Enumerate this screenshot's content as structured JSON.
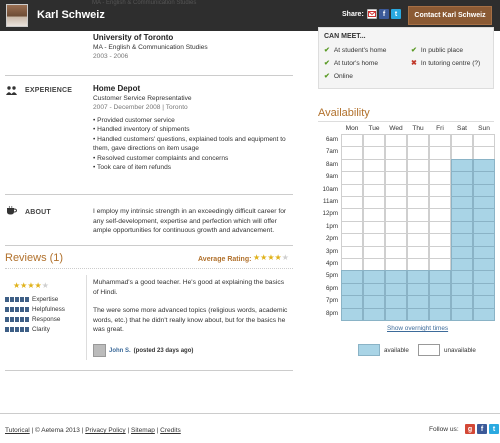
{
  "header": {
    "name": "Karl Schweiz",
    "ghost_text": "MA - English & Communication Studies",
    "share_label": "Share:",
    "contact_label": "Contact Karl Schweiz"
  },
  "education": {
    "school": "University of Toronto",
    "degree": "MA - English & Communication Studies",
    "dates": "2003 - 2006"
  },
  "experience": {
    "label": "EXPERIENCE",
    "company": "Home Depot",
    "role": "Customer Service Representative",
    "dates": "2007 - December 2008 | Toronto",
    "bullets": [
      "• Provided customer service",
      "• Handled inventory of shipments",
      "• Handled customers' questions, explained tools and equipment to",
      "them, gave directions on item usage",
      "• Resolved customer complaints and concerns",
      "• Took care of item refunds"
    ]
  },
  "about": {
    "label": "ABOUT",
    "text": "I employ my intrinsic strength in an exceedingly difficult career for any self-development, expertise and perfection which will offer ample opportunities for continuous growth and advancement."
  },
  "reviews": {
    "title": "Reviews (1)",
    "avg_label": "Average Rating:",
    "avg_stars": 4,
    "review_stars": 4,
    "metrics": [
      {
        "label": "Expertise",
        "score": 5
      },
      {
        "label": "Helpfulness",
        "score": 5
      },
      {
        "label": "Response",
        "score": 5
      },
      {
        "label": "Clarity",
        "score": 5
      }
    ],
    "text_1": "Muhammad's a good teacher. He's good at explaining the basics of Hindi.",
    "text_2": "The were some more advanced topics (religious words, academic words, etc.) that he didn't really know about, but for the basics he was great.",
    "reviewer_name": "John S.",
    "reviewer_time": "(posted 23 days ago)"
  },
  "can_meet": {
    "title": "CAN MEET...",
    "options": [
      {
        "label": "At student's home",
        "allowed": true
      },
      {
        "label": "In public place",
        "allowed": true
      },
      {
        "label": "At tutor's home",
        "allowed": true
      },
      {
        "label": "In tutoring centre (?)",
        "allowed": false
      },
      {
        "label": "Online",
        "allowed": true
      }
    ]
  },
  "availability": {
    "title": "Availability",
    "days": [
      "Mon",
      "Tue",
      "Wed",
      "Thu",
      "Fri",
      "Sat",
      "Sun"
    ],
    "times": [
      "6am",
      "7am",
      "8am",
      "9am",
      "10am",
      "11am",
      "12pm",
      "1pm",
      "2pm",
      "3pm",
      "4pm",
      "5pm",
      "6pm",
      "7pm",
      "8pm"
    ],
    "available": [
      [
        0,
        0,
        0,
        0,
        0,
        0,
        0
      ],
      [
        0,
        0,
        0,
        0,
        0,
        0,
        0
      ],
      [
        0,
        0,
        0,
        0,
        0,
        1,
        1
      ],
      [
        0,
        0,
        0,
        0,
        0,
        1,
        1
      ],
      [
        0,
        0,
        0,
        0,
        0,
        1,
        1
      ],
      [
        0,
        0,
        0,
        0,
        0,
        1,
        1
      ],
      [
        0,
        0,
        0,
        0,
        0,
        1,
        1
      ],
      [
        0,
        0,
        0,
        0,
        0,
        1,
        1
      ],
      [
        0,
        0,
        0,
        0,
        0,
        1,
        1
      ],
      [
        0,
        0,
        0,
        0,
        0,
        1,
        1
      ],
      [
        0,
        0,
        0,
        0,
        0,
        1,
        1
      ],
      [
        1,
        1,
        1,
        1,
        1,
        1,
        1
      ],
      [
        1,
        1,
        1,
        1,
        1,
        1,
        1
      ],
      [
        1,
        1,
        1,
        1,
        1,
        1,
        1
      ],
      [
        1,
        1,
        1,
        1,
        1,
        1,
        1
      ]
    ],
    "overnight_link": "Show overnight times",
    "legend_available": "available",
    "legend_unavailable": "unavailable",
    "color_available": "#a9d4e6"
  },
  "footer": {
    "tutorical": "Tutorical",
    "copyright": "© Aetema 2013",
    "privacy": "Privacy Policy",
    "sitemap": "Sitemap",
    "credits": "Credits",
    "follow": "Follow us:"
  }
}
